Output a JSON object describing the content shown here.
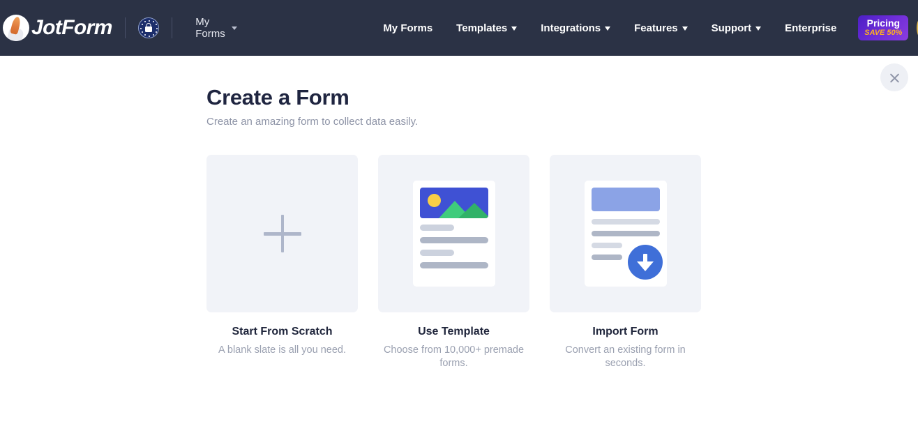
{
  "header": {
    "logo_text": "JotForm",
    "logo_icon": "jotform-pen-logo-icon",
    "gdpr_icon": "gdpr-lock-badge-icon",
    "workspace_menu": {
      "label": "My Forms",
      "caret_icon": "chevron-down-icon"
    },
    "nav": [
      {
        "label": "My Forms",
        "has_caret": false
      },
      {
        "label": "Templates",
        "has_caret": true
      },
      {
        "label": "Integrations",
        "has_caret": true
      },
      {
        "label": "Features",
        "has_caret": true
      },
      {
        "label": "Support",
        "has_caret": true
      },
      {
        "label": "Enterprise",
        "has_caret": false
      }
    ],
    "pricing": {
      "title": "Pricing",
      "promo": "SAVE 50%"
    },
    "avatar_icon": "user-avatar-cat-icon",
    "colors": {
      "header_bg": "#2b3245",
      "pricing_gradient_start": "#4b1fc4",
      "pricing_gradient_end": "#8a3ce0",
      "promo_text": "#ffb020"
    }
  },
  "main": {
    "close_icon": "close-x-icon",
    "title": "Create a Form",
    "subtitle": "Create an amazing form to collect data easily.",
    "cards": [
      {
        "title": "Start From Scratch",
        "description": "A blank slate is all you need.",
        "icon": "plus-icon"
      },
      {
        "title": "Use Template",
        "description": "Choose from 10,000+ premade forms.",
        "icon": "template-document-icon"
      },
      {
        "title": "Import Form",
        "description": "Convert an existing form in seconds.",
        "icon": "import-download-document-icon"
      }
    ],
    "colors": {
      "page_bg": "#ffffff",
      "tile_bg": "#f1f3f8",
      "title_text": "#1f2540",
      "muted_text": "#8d93a6",
      "plus_icon": "#aeb6ca",
      "template_image_blue": "#3f51d4",
      "template_sun_yellow": "#f8cf46",
      "template_mountain_green": "#3fcc7c",
      "import_head_blue": "#8ba3e6",
      "import_circle_blue": "#3f6fd8"
    }
  }
}
